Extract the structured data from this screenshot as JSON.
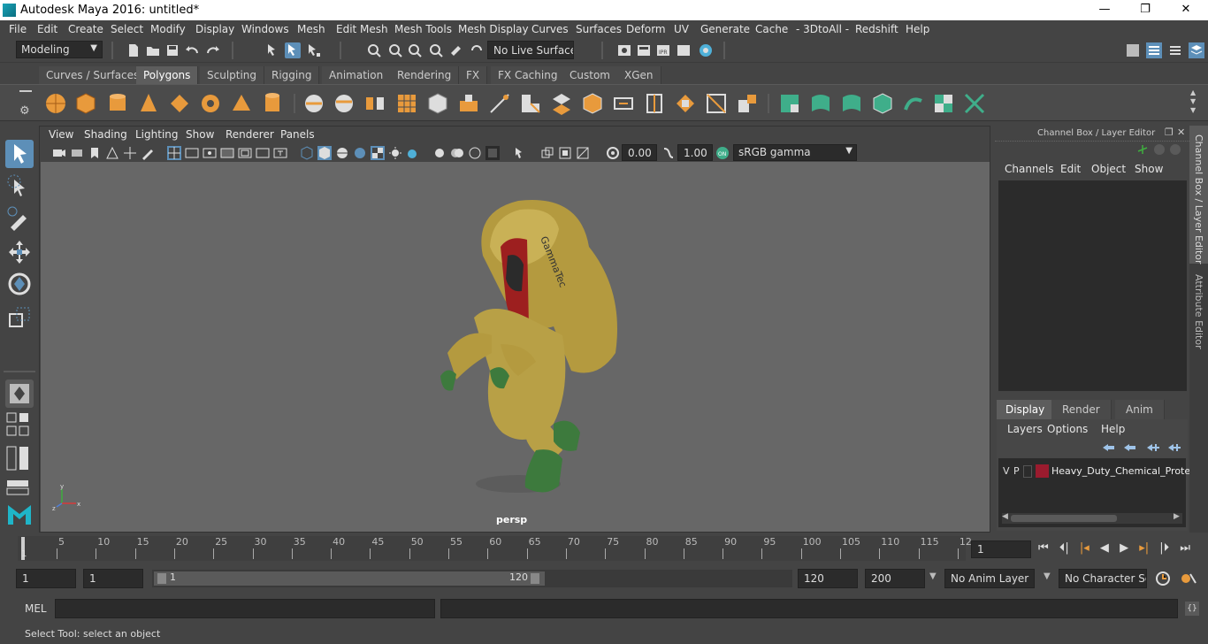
{
  "window": {
    "title": "Autodesk Maya 2016: untitled*",
    "min": "—",
    "restore": "❐",
    "close": "✕"
  },
  "menu": [
    "File",
    "Edit",
    "Create",
    "Select",
    "Modify",
    "Display",
    "Windows",
    "Mesh",
    "Edit Mesh",
    "Mesh Tools",
    "Mesh Display",
    "Curves",
    "Surfaces",
    "Deform",
    "UV",
    "Generate",
    "Cache",
    "- 3DtoAll -",
    "Redshift",
    "Help"
  ],
  "statusline": {
    "mode": "Modeling",
    "live_surface": "No Live Surface"
  },
  "shelf_tabs": [
    "Curves / Surfaces",
    "Polygons",
    "Sculpting",
    "Rigging",
    "Animation",
    "Rendering",
    "FX",
    "FX Caching",
    "Custom",
    "XGen"
  ],
  "shelf_active": "Polygons",
  "panel_menu": [
    "View",
    "Shading",
    "Lighting",
    "Show",
    "Renderer",
    "Panels"
  ],
  "panel_tools": {
    "exposure": "0.00",
    "gamma": "1.00",
    "color_space": "sRGB gamma"
  },
  "viewport": {
    "camera": "persp",
    "model_label": "GammaTec"
  },
  "channel_box": {
    "title": "Channel Box / Layer Editor",
    "menu": [
      "Channels",
      "Edit",
      "Object",
      "Show"
    ]
  },
  "layer_editor": {
    "tabs": [
      "Display",
      "Render",
      "Anim"
    ],
    "active": "Display",
    "menu": [
      "Layers",
      "Options",
      "Help"
    ],
    "layer": {
      "v": "V",
      "p": "P",
      "name": "Heavy_Duty_Chemical_Protec",
      "color": "#9a1b2e"
    }
  },
  "side_tabs": {
    "channel": "Channel Box / Layer Editor",
    "attr": "Attribute Editor"
  },
  "timeline": {
    "ticks": [
      "5",
      "10",
      "15",
      "20",
      "25",
      "30",
      "35",
      "40",
      "45",
      "50",
      "55",
      "60",
      "65",
      "70",
      "75",
      "80",
      "85",
      "90",
      "95",
      "100",
      "105",
      "110",
      "115",
      "12"
    ],
    "start_marker": "1",
    "current": "1"
  },
  "range": {
    "start": "1",
    "inner_start": "1",
    "slider_start": "1",
    "slider_end": "120",
    "end": "120",
    "max": "200",
    "anim_layer": "No Anim Layer",
    "char_set": "No Character Set"
  },
  "cmd": {
    "label": "MEL"
  },
  "help": {
    "text": "Select Tool: select an object"
  },
  "colors": {
    "accent": "#5d8fb8",
    "bg": "#444444",
    "viewport": "#676767"
  }
}
